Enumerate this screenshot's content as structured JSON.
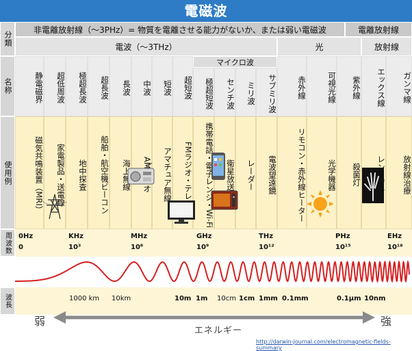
{
  "title": "電磁波",
  "side_labels": {
    "category": "分類",
    "name": "名称",
    "usage": "使用例",
    "frequency": "周波数",
    "wavelength": "波長"
  },
  "row1": {
    "non_ionizing": "非電離放射線（～3PHz）= 物質を電離させる能力がないか、または弱い電磁波",
    "ionizing": "電離放射線"
  },
  "row2": {
    "radio": "電波（～3THz）",
    "light": "光",
    "radiation": "放射線"
  },
  "microwave": "マイクロ波",
  "names": [
    "静電磁界",
    "超低周波",
    "極超長波",
    "超長波",
    "長波",
    "中波",
    "短波",
    "超短波",
    "極超短波",
    "センチ波",
    "ミリ波",
    "サブミリ波",
    "赤外線",
    "可視光線",
    "紫外線",
    "エックス線",
    "ガンマ線"
  ],
  "usages": [
    "磁気共鳴装置（MRI）",
    "家電製品・送電線",
    "地中探査",
    "船舶・航空機ビーコン",
    "海上無線",
    "AMラジオ",
    "アマチュア無線",
    "FMラジオ・テレビ",
    "携帯電話・電子レンジ・Wi-Fi",
    "衛星放送",
    "レーダー",
    "電波望遠鏡",
    "リモコン・赤外線ヒーター",
    "光学機器",
    "殺菌灯",
    "レントゲン",
    "放射線治療"
  ],
  "frequencies": [
    {
      "unit": "0Hz",
      "exp": "0"
    },
    {
      "unit": "KHz",
      "exp": "10³"
    },
    {
      "unit": "MHz",
      "exp": "10⁶"
    },
    {
      "unit": "GHz",
      "exp": "10⁹"
    },
    {
      "unit": "THz",
      "exp": "10¹²"
    },
    {
      "unit": "PHz",
      "exp": "10¹⁵"
    },
    {
      "unit": "EHz",
      "exp": "10¹⁸"
    }
  ],
  "wavelengths": [
    "1000 km",
    "10km",
    "10m",
    "1m",
    "10cm",
    "1cm",
    "1mm",
    "0.1mm",
    "0.1μm",
    "10nm"
  ],
  "energy": {
    "weak": "弱",
    "label": "エネルギー",
    "strong": "強"
  },
  "source_url": "http://darwin-journal.com/electromagnetic-fields-summary",
  "colors": {
    "title_bg": "#2e7cc6",
    "usage_bg": "#fdf2c7",
    "wave": "#d62020"
  },
  "icons": [
    "power-tower-icon",
    "radio-icon",
    "tv-icon",
    "smartphone-icon",
    "microwave-oven-icon",
    "sun-icon",
    "xray-hand-icon"
  ]
}
